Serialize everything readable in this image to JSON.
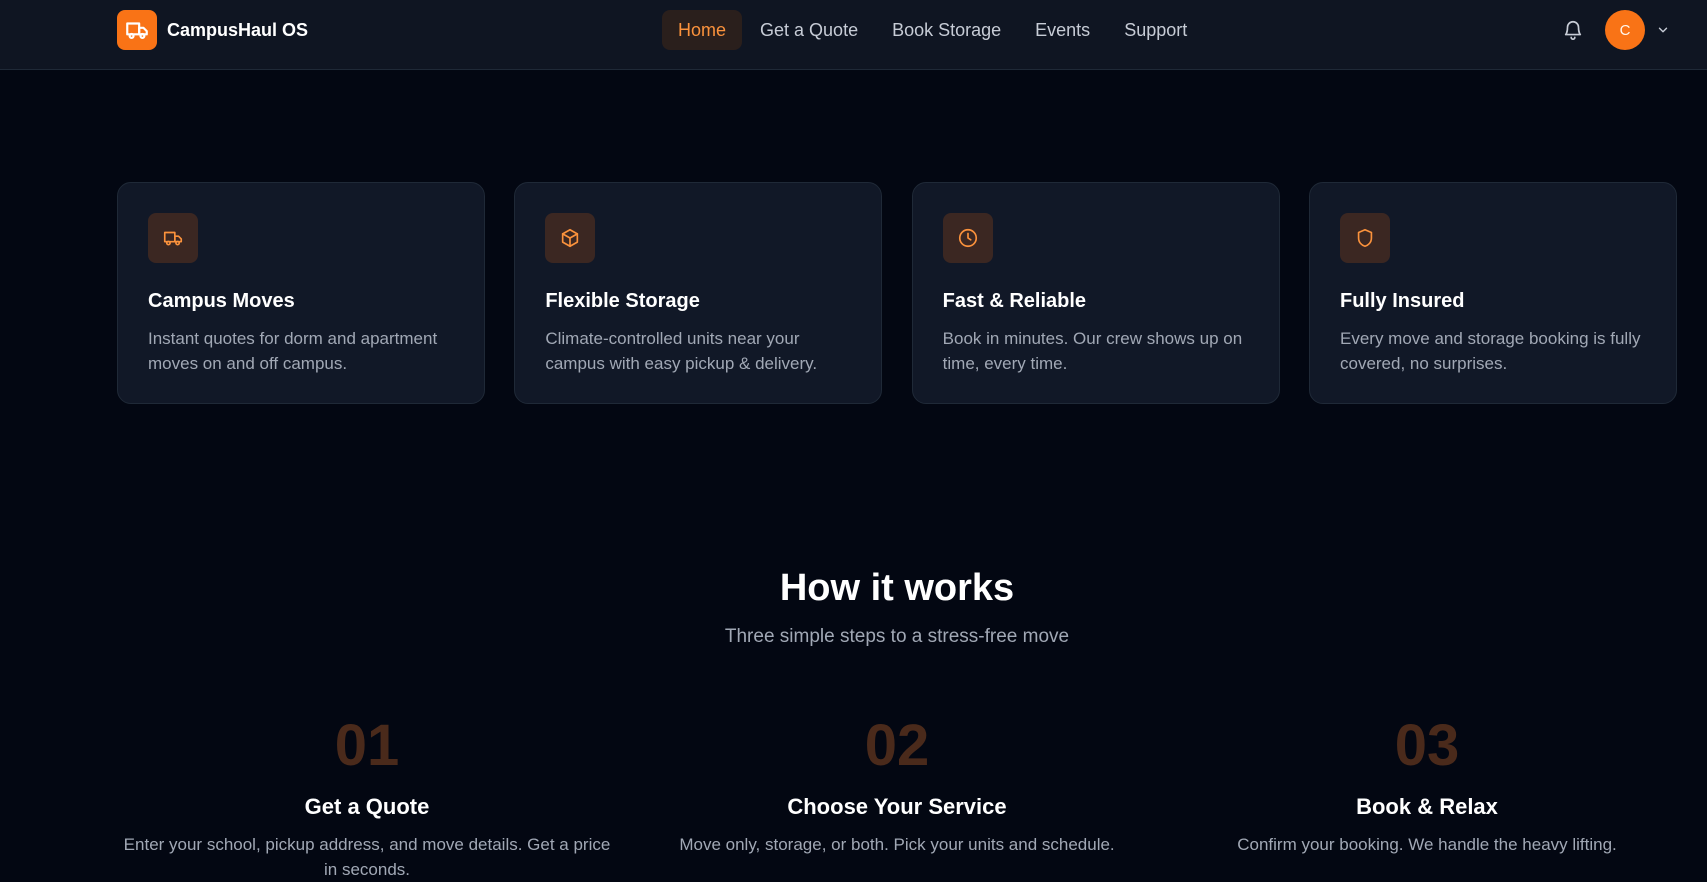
{
  "header": {
    "brand_name": "CampusHaul OS",
    "brand_icon": "truck-icon",
    "nav": [
      {
        "label": "Home",
        "active": true
      },
      {
        "label": "Get a Quote",
        "active": false
      },
      {
        "label": "Book Storage",
        "active": false
      },
      {
        "label": "Events",
        "active": false
      },
      {
        "label": "Support",
        "active": false
      }
    ],
    "avatar_initial": "C",
    "bell_icon": "bell-icon",
    "menu_icon": "chevron-down-icon"
  },
  "features": [
    {
      "icon": "truck-icon",
      "title": "Campus Moves",
      "description": "Instant quotes for dorm and apartment moves on and off campus."
    },
    {
      "icon": "box-icon",
      "title": "Flexible Storage",
      "description": "Climate-controlled units near your campus with easy pickup & delivery."
    },
    {
      "icon": "clock-icon",
      "title": "Fast & Reliable",
      "description": "Book in minutes. Our crew shows up on time, every time."
    },
    {
      "icon": "shield-icon",
      "title": "Fully Insured",
      "description": "Every move and storage booking is fully covered, no surprises."
    }
  ],
  "how_it_works": {
    "title": "How it works",
    "subtitle": "Three simple steps to a stress-free move",
    "steps": [
      {
        "number": "01",
        "title": "Get a Quote",
        "description": "Enter your school, pickup address, and move details. Get a price in seconds."
      },
      {
        "number": "02",
        "title": "Choose Your Service",
        "description": "Move only, storage, or both. Pick your units and schedule."
      },
      {
        "number": "03",
        "title": "Book & Relax",
        "description": "Confirm your booking. We handle the heavy lifting."
      }
    ]
  },
  "colors": {
    "accent": "#f97316",
    "background": "#030712",
    "card": "#111827"
  }
}
